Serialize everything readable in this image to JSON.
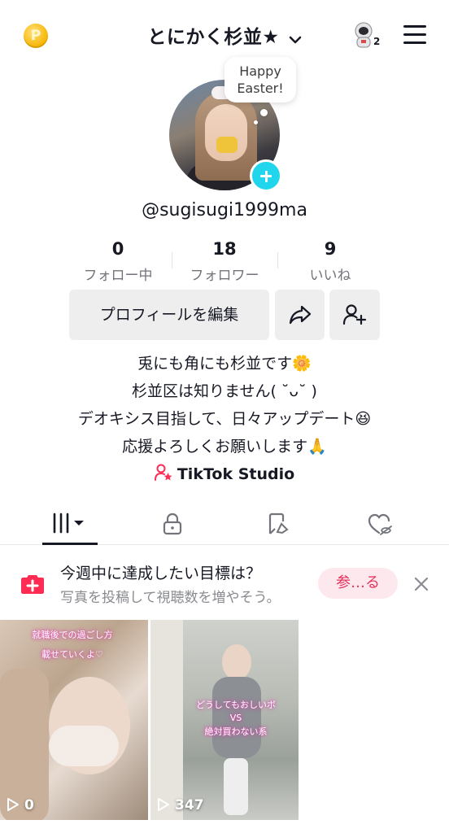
{
  "header": {
    "title": "とにかく杉並★",
    "notification_count": "2",
    "coin_label": "P"
  },
  "profile": {
    "bubble_line1": "Happy",
    "bubble_line2": "Easter!",
    "username": "@sugisugi1999ma"
  },
  "stats": [
    {
      "value": "0",
      "label": "フォロー中"
    },
    {
      "value": "18",
      "label": "フォロワー"
    },
    {
      "value": "9",
      "label": "いいね"
    }
  ],
  "actions": {
    "edit_label": "プロフィールを編集"
  },
  "bio": [
    "兎にも角にも杉並です🌼",
    "杉並区は知りません( ˘ᴗ˘ )",
    "デオキシス目指して、日々アップデート😆",
    "応援よろしくお願いします🙏"
  ],
  "studio_label": "TikTok Studio",
  "tabs": [
    "videos",
    "private",
    "reposts",
    "liked"
  ],
  "banner": {
    "title": "今週中に達成したい目標は？",
    "subtitle": "写真を投稿して視聴数を増やそう。",
    "button_label": "参…る"
  },
  "videos": [
    {
      "views": "0",
      "caption_line1": "就職後での過ごし方",
      "caption_line2": "載せていくよ♡"
    },
    {
      "views": "347",
      "caption_line1": "どうしてもおしいボ",
      "caption_line2": "VS",
      "caption_line3": "絶対買わない系"
    }
  ],
  "colors": {
    "accent_cyan": "#20d5ec",
    "brand_red": "#fe2c55",
    "button_bg": "#eeeeef",
    "text_primary": "#161823",
    "text_secondary": "#73747b"
  }
}
